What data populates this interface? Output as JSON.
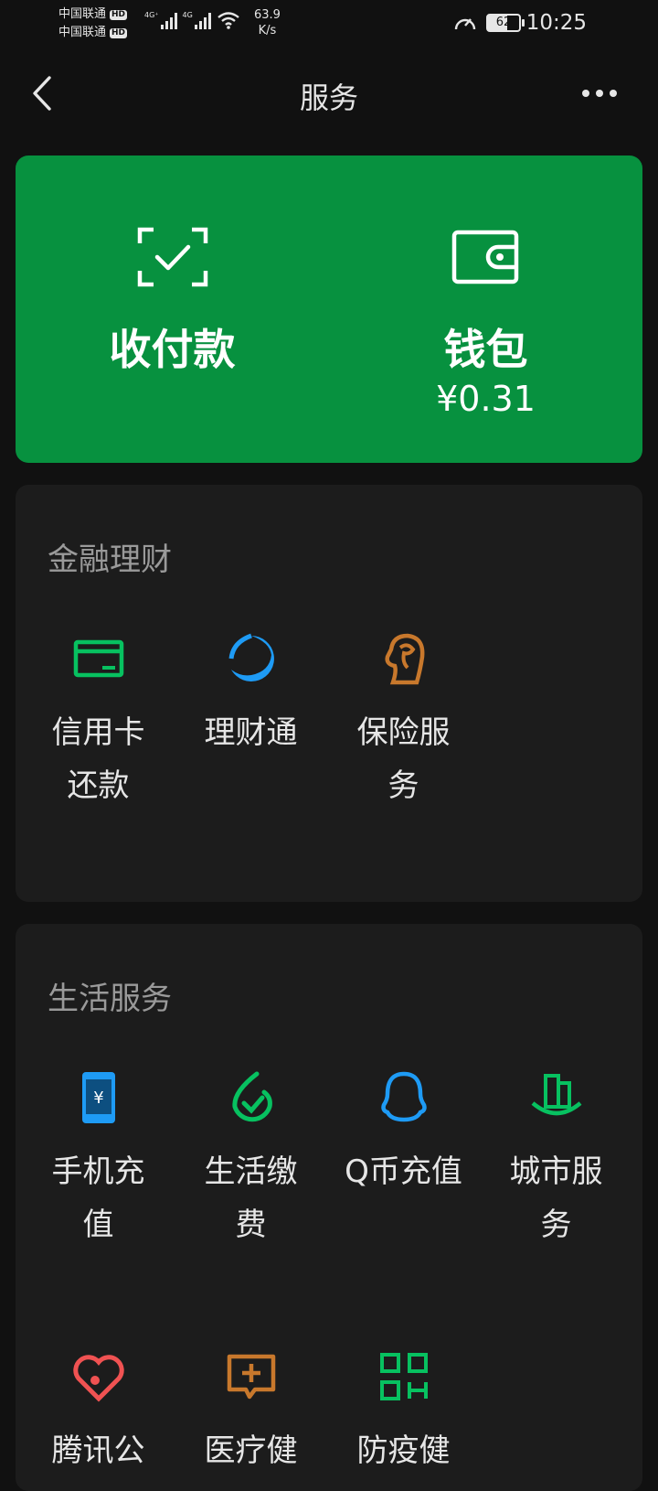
{
  "status_bar": {
    "carrier_1": "中国联通",
    "carrier_2": "中国联通",
    "hd_badge": "HD",
    "net_type_1": "4G⁺",
    "net_type_2": "4G",
    "speed_value": "63.9",
    "speed_unit": "K/s",
    "battery": "62",
    "time": "10:25"
  },
  "nav": {
    "title": "服务"
  },
  "pay_card": {
    "collect_label": "收付款",
    "wallet_label": "钱包",
    "wallet_amount": "¥0.31",
    "bg_color": "#07913f"
  },
  "finance": {
    "title": "金融理财",
    "items": [
      {
        "label": "信用卡还款",
        "icon": "credit-card-icon",
        "color": "#07c160"
      },
      {
        "label": "理财通",
        "icon": "wealth-icon",
        "color": "#1e9bf5"
      },
      {
        "label": "保险服务",
        "icon": "insurance-icon",
        "color": "#c8782c"
      }
    ]
  },
  "life": {
    "title": "生活服务",
    "items": [
      {
        "label": "手机充值",
        "icon": "phone-topup-icon",
        "color": "#1e9bf5"
      },
      {
        "label": "生活缴费",
        "icon": "utility-payment-icon",
        "color": "#07c160"
      },
      {
        "label": "Q币充值",
        "icon": "qq-coin-icon",
        "color": "#1e9bf5"
      },
      {
        "label": "城市服务",
        "icon": "city-service-icon",
        "color": "#07c160"
      },
      {
        "label": "腾讯公",
        "icon": "charity-icon",
        "color": "#f05252"
      },
      {
        "label": "医疗健",
        "icon": "medical-icon",
        "color": "#c8782c"
      },
      {
        "label": "防疫健",
        "icon": "health-code-icon",
        "color": "#07c160"
      }
    ]
  }
}
